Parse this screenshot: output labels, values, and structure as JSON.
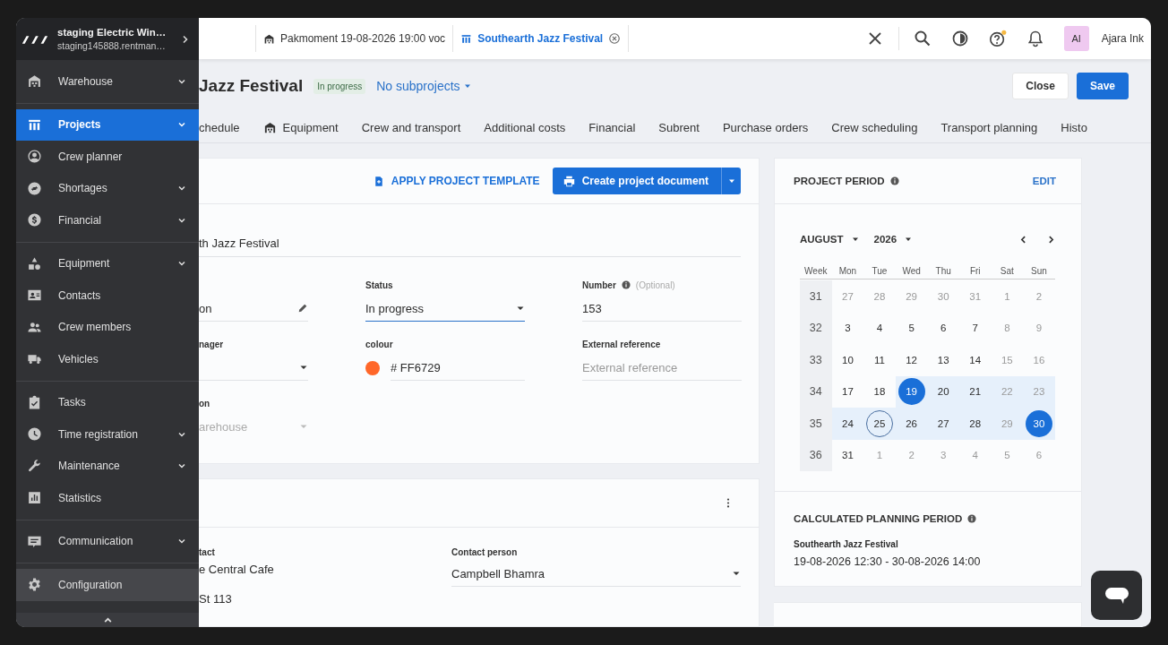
{
  "sidebar": {
    "account": {
      "name": "staging Electric Win…",
      "url": "staging145888.rentman…"
    },
    "groups": [
      {
        "items": [
          {
            "label": "Warehouse",
            "expandable": true,
            "selected": false,
            "hovered": false
          }
        ]
      },
      {
        "items": [
          {
            "label": "Projects",
            "expandable": true,
            "selected": true,
            "hovered": false
          },
          {
            "label": "Crew planner",
            "expandable": false,
            "selected": false,
            "hovered": false
          },
          {
            "label": "Shortages",
            "expandable": true,
            "selected": false,
            "hovered": false
          },
          {
            "label": "Financial",
            "expandable": true,
            "selected": false,
            "hovered": false
          }
        ]
      },
      {
        "items": [
          {
            "label": "Equipment",
            "expandable": true,
            "selected": false,
            "hovered": false
          },
          {
            "label": "Contacts",
            "expandable": false,
            "selected": false,
            "hovered": false
          },
          {
            "label": "Crew members",
            "expandable": false,
            "selected": false,
            "hovered": false
          },
          {
            "label": "Vehicles",
            "expandable": false,
            "selected": false,
            "hovered": false
          }
        ]
      },
      {
        "items": [
          {
            "label": "Tasks",
            "expandable": false,
            "selected": false,
            "hovered": false
          },
          {
            "label": "Time registration",
            "expandable": true,
            "selected": false,
            "hovered": false
          },
          {
            "label": "Maintenance",
            "expandable": true,
            "selected": false,
            "hovered": false
          },
          {
            "label": "Statistics",
            "expandable": false,
            "selected": false,
            "hovered": false
          }
        ]
      },
      {
        "items": [
          {
            "label": "Communication",
            "expandable": true,
            "selected": false,
            "hovered": false
          }
        ]
      },
      {
        "items": [
          {
            "label": "Configuration",
            "expandable": false,
            "selected": false,
            "hovered": true
          }
        ]
      }
    ]
  },
  "top_bar": {
    "tabs": [
      {
        "label": "Pakmoment 19-08-2026 19:00 voc",
        "selected": false,
        "closable": false
      },
      {
        "label": "Southearth Jazz Festival",
        "selected": true,
        "closable": true
      }
    ],
    "help_badge": true,
    "user": {
      "initials": "AI",
      "name": "Ajara Ink"
    }
  },
  "header": {
    "title": "Jazz Festival",
    "status": "In progress",
    "subprojects": "No subprojects",
    "buttons": [
      {
        "label": "Close",
        "kind": "secondary"
      },
      {
        "label": "Save",
        "kind": "primary"
      }
    ]
  },
  "tabs": [
    {
      "label": "chedule",
      "selected": false,
      "icon": false
    },
    {
      "label": "Equipment",
      "selected": false,
      "icon": true
    },
    {
      "label": "Crew and transport",
      "selected": false,
      "icon": false
    },
    {
      "label": "Additional costs",
      "selected": false,
      "icon": false
    },
    {
      "label": "Financial",
      "selected": false,
      "icon": false
    },
    {
      "label": "Subrent",
      "selected": false,
      "icon": false
    },
    {
      "label": "Purchase orders",
      "selected": false,
      "icon": false
    },
    {
      "label": "Crew scheduling",
      "selected": false,
      "icon": false
    },
    {
      "label": "Transport planning",
      "selected": false,
      "icon": false
    },
    {
      "label": "Histo",
      "selected": false,
      "icon": false
    }
  ],
  "project_card": {
    "template_link": "APPLY PROJECT TEMPLATE",
    "document_button": "Create project document",
    "name_value": "th Jazz Festival",
    "fields": [
      {
        "kind": "edit",
        "value": "on",
        "focused": false,
        "disabled": false
      },
      {
        "kind": "select",
        "label": "Status",
        "value": "In progress",
        "focused": true,
        "disabled": false
      },
      {
        "kind": "text",
        "label": "Number",
        "info": true,
        "hint": "(Optional)",
        "value": "153",
        "focused": false,
        "disabled": false
      },
      {
        "kind": "select",
        "label": "nager",
        "focused": false,
        "disabled": false
      },
      {
        "kind": "color",
        "label": "colour",
        "value": "# FF6729",
        "color": "#ff6729",
        "focused": false,
        "disabled": false
      },
      {
        "kind": "text",
        "label": "External reference",
        "placeholder": "External reference",
        "focused": false,
        "disabled": false
      },
      {
        "kind": "select",
        "label": "on",
        "value": "arehouse",
        "focused": false,
        "disabled": true
      }
    ]
  },
  "contact_card": {
    "left": [
      {
        "label": "tact",
        "value": "e Central Cafe"
      },
      {
        "value": "St 113"
      }
    ],
    "right": {
      "label": "Contact person",
      "value": "Campbell Bhamra"
    }
  },
  "period_card": {
    "title": "PROJECT PERIOD",
    "edit": "EDIT",
    "month": "AUGUST",
    "year": "2026",
    "weekdays": [
      "Week",
      "Mon",
      "Tue",
      "Wed",
      "Thu",
      "Fri",
      "Sat",
      "Sun"
    ],
    "weeks": [
      {
        "number": "31",
        "days": [
          {
            "label": "27",
            "kind": "dim"
          },
          {
            "label": "28",
            "kind": "dim"
          },
          {
            "label": "29",
            "kind": "dim"
          },
          {
            "label": "30",
            "kind": "dim"
          },
          {
            "label": "31",
            "kind": "dim"
          },
          {
            "label": "1",
            "kind": "dim"
          },
          {
            "label": "2",
            "kind": "dim"
          }
        ]
      },
      {
        "number": "32",
        "days": [
          {
            "label": "3",
            "kind": "plain"
          },
          {
            "label": "4",
            "kind": "plain"
          },
          {
            "label": "5",
            "kind": "plain"
          },
          {
            "label": "6",
            "kind": "plain"
          },
          {
            "label": "7",
            "kind": "plain"
          },
          {
            "label": "8",
            "kind": "dim"
          },
          {
            "label": "9",
            "kind": "dim"
          }
        ]
      },
      {
        "number": "33",
        "days": [
          {
            "label": "10",
            "kind": "plain"
          },
          {
            "label": "11",
            "kind": "plain"
          },
          {
            "label": "12",
            "kind": "plain"
          },
          {
            "label": "13",
            "kind": "plain"
          },
          {
            "label": "14",
            "kind": "plain"
          },
          {
            "label": "15",
            "kind": "dim"
          },
          {
            "label": "16",
            "kind": "dim"
          }
        ]
      },
      {
        "number": "34",
        "days": [
          {
            "label": "17",
            "kind": "plain"
          },
          {
            "label": "18",
            "kind": "plain"
          },
          {
            "label": "19",
            "kind": "endpoint"
          },
          {
            "label": "20",
            "kind": "range"
          },
          {
            "label": "21",
            "kind": "range"
          },
          {
            "label": "22",
            "kind": "range_dim"
          },
          {
            "label": "23",
            "kind": "range_dim"
          }
        ]
      },
      {
        "number": "35",
        "days": [
          {
            "label": "24",
            "kind": "range"
          },
          {
            "label": "25",
            "kind": "today_range"
          },
          {
            "label": "26",
            "kind": "range"
          },
          {
            "label": "27",
            "kind": "range"
          },
          {
            "label": "28",
            "kind": "range"
          },
          {
            "label": "29",
            "kind": "range_dim"
          },
          {
            "label": "30",
            "kind": "endpoint"
          }
        ]
      },
      {
        "number": "36",
        "days": [
          {
            "label": "31",
            "kind": "plain"
          },
          {
            "label": "1",
            "kind": "dim"
          },
          {
            "label": "2",
            "kind": "dim"
          },
          {
            "label": "3",
            "kind": "dim"
          },
          {
            "label": "4",
            "kind": "dim"
          },
          {
            "label": "5",
            "kind": "dim"
          },
          {
            "label": "6",
            "kind": "dim"
          }
        ]
      }
    ],
    "planning": {
      "title": "CALCULATED PLANNING PERIOD",
      "name": "Southearth Jazz Festival",
      "range": "19-08-2026 12:30 - 30-08-2026 14:00"
    }
  }
}
